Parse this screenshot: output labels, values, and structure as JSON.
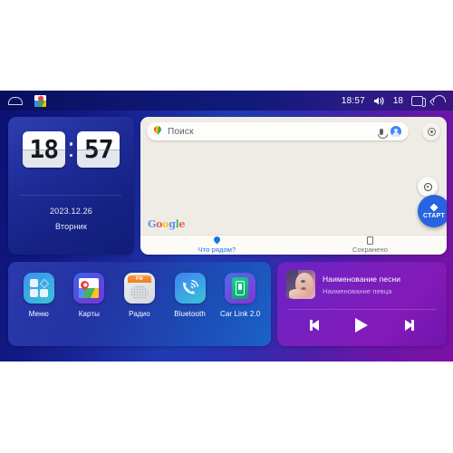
{
  "statusbar": {
    "home_icon": "home-icon",
    "maps_icon": "google-maps-icon",
    "time": "18:57",
    "volume_icon": "volume-icon",
    "volume_level": "18",
    "recents_icon": "recents-icon",
    "back_icon": "back-icon"
  },
  "clock": {
    "hours": "18",
    "minutes": "57",
    "date": "2023.12.26",
    "weekday": "Вторник"
  },
  "maps": {
    "search_placeholder": "Поиск",
    "pin_icon": "maps-pin-icon",
    "mic_icon": "microphone-icon",
    "account_icon": "account-avatar-icon",
    "layers_icon": "map-settings-icon",
    "locate_icon": "my-location-icon",
    "start_label": "СТАРТ",
    "attribution": "Google",
    "tabs": [
      {
        "label": "Что рядом?",
        "icon": "location-pin-icon",
        "active": true
      },
      {
        "label": "Сохранено",
        "icon": "bookmark-icon",
        "active": false
      }
    ]
  },
  "dock": {
    "apps": [
      {
        "label": "Меню",
        "icon": "apps-grid-icon"
      },
      {
        "label": "Карты",
        "icon": "google-maps-icon"
      },
      {
        "label": "Радио",
        "icon": "fm-radio-icon"
      },
      {
        "label": "Bluetooth",
        "icon": "bluetooth-phone-icon"
      },
      {
        "label": "Car Link 2.0",
        "icon": "car-link-icon"
      }
    ]
  },
  "music": {
    "album_art": "album-art-image",
    "track_title": "Наименование песни",
    "artist": "Наименование певца",
    "prev_icon": "previous-track-icon",
    "play_icon": "play-icon",
    "next_icon": "next-track-icon"
  },
  "colors": {
    "background_start": "#0b1172",
    "background_end": "#7d10a6",
    "accent_blue": "#2764e0",
    "maps_paper": "#efece5",
    "music_purple": "#7a1fbe"
  }
}
